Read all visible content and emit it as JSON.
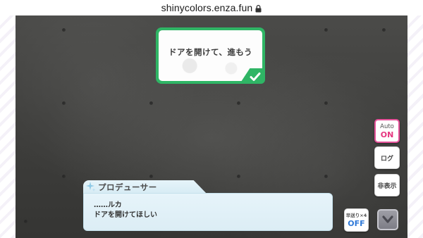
{
  "browser": {
    "url": "shinycolors.enza.fun"
  },
  "choice": {
    "text": "ドアを開けて、進もう"
  },
  "dialogue": {
    "speaker": "プロデューサー",
    "lines": [
      "……ルカ",
      "ドアを開けてほしい"
    ]
  },
  "controls": {
    "auto_label": "Auto",
    "auto_state": "ON",
    "log_label": "ログ",
    "hide_label": "非表示",
    "fast_label": "早送り×4",
    "fast_state": "OFF"
  },
  "colors": {
    "choice_accent": "#2fb565",
    "auto_accent": "#e6357f",
    "fast_accent": "#2f79d8",
    "dialog_bg": "#e6f4fa"
  },
  "icons": [
    "lock-icon",
    "check-icon",
    "sparkle-icon",
    "chevron-down-icon"
  ]
}
